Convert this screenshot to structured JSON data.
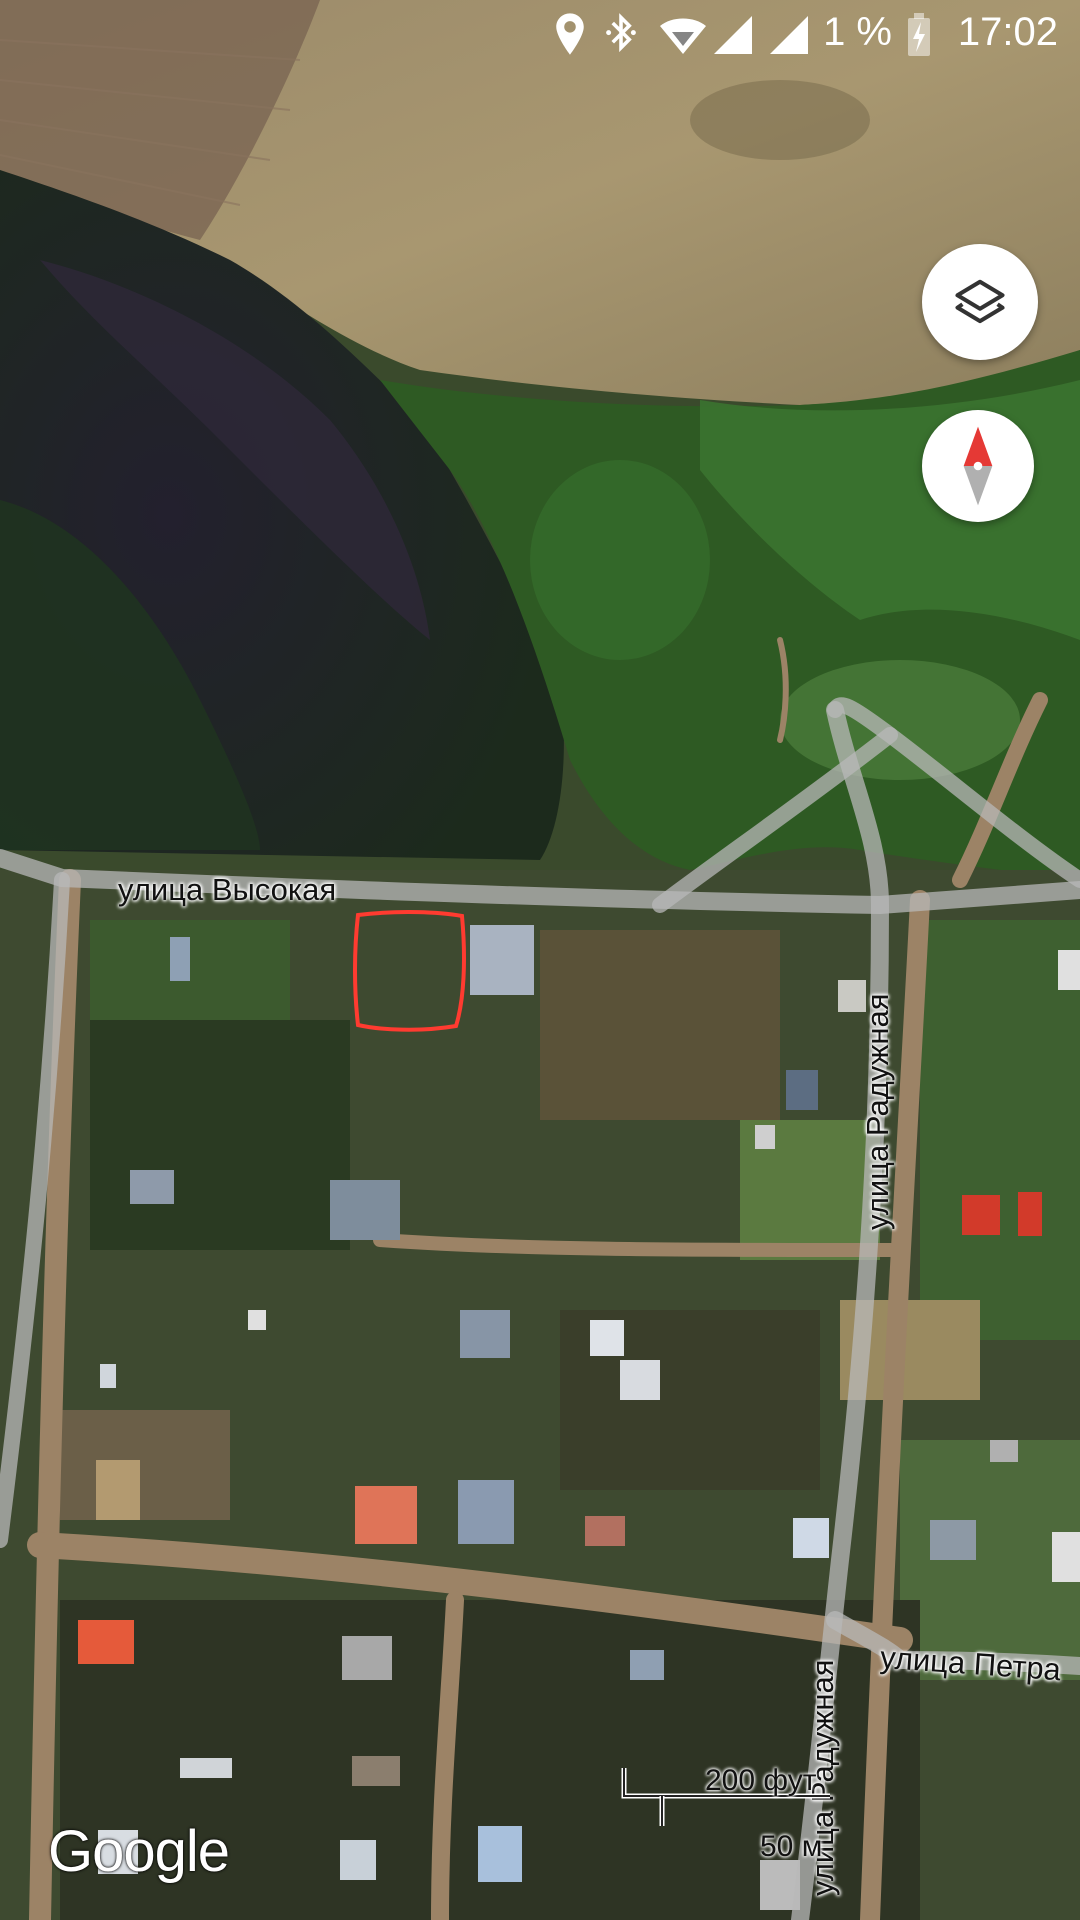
{
  "status_bar": {
    "time": "17:02",
    "battery_percent": "1 %",
    "icons": [
      "location-icon",
      "bluetooth-icon",
      "wifi-icon",
      "signal-icon",
      "signal-icon",
      "battery-charging-icon"
    ]
  },
  "map": {
    "type": "satellite",
    "attribution": "Google",
    "streets": {
      "vysokaya": "улица Высокая",
      "radugnaya_1": "улица Радужная",
      "radugnaya_2": "улица Радужная",
      "petra": "улица Петра"
    },
    "scale": {
      "feet": "200 фут",
      "meters": "50 м"
    },
    "highlight_color": "#ff3b30"
  },
  "buttons": {
    "layers": "layers-icon",
    "compass": "compass-icon"
  }
}
